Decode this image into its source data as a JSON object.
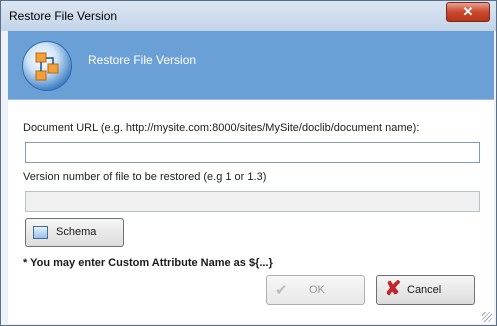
{
  "window": {
    "title": "Restore File Version",
    "close_glyph": "✕"
  },
  "banner": {
    "title": "Restore File Version",
    "icon": "workflow-icon"
  },
  "form": {
    "url_label": "Document URL (e.g. http://mysite.com:8000/sites/MySite/doclib/document name):",
    "url_value": "",
    "version_label": "Version number of file to be restored (e.g 1 or 1.3)",
    "version_value": ""
  },
  "buttons": {
    "schema_label": "Schema",
    "ok_label": "OK",
    "ok_icon_glyph": "✔",
    "cancel_label": "Cancel",
    "cancel_icon_glyph": "✘"
  },
  "note": "* You may enter Custom Attribute Name as ${...}",
  "colors": {
    "banner": "#6ba0d6",
    "close": "#c9482e"
  }
}
